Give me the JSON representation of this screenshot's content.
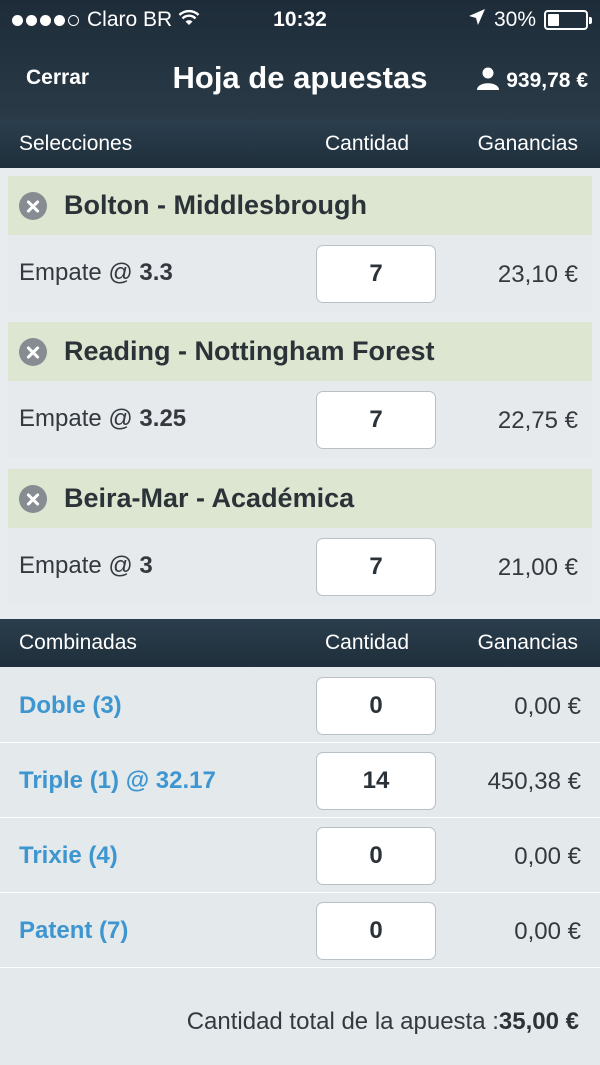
{
  "status_bar": {
    "carrier": "Claro BR",
    "time": "10:32",
    "battery_text": "30%",
    "battery_level": 0.3,
    "signal_bars": 4
  },
  "navbar": {
    "close_label": "Cerrar",
    "title": "Hoja de apuestas",
    "balance": "939,78 €"
  },
  "selections_header": {
    "col1": "Selecciones",
    "col2": "Cantidad",
    "col3": "Ganancias"
  },
  "selections": [
    {
      "match": "Bolton - Middlesbrough",
      "pick_label": "Empate @ ",
      "odds": "3.3",
      "stake": "7",
      "winnings": "23,10 €"
    },
    {
      "match": "Reading - Nottingham Forest",
      "pick_label": "Empate @ ",
      "odds": "3.25",
      "stake": "7",
      "winnings": "22,75 €"
    },
    {
      "match": "Beira-Mar - Académica",
      "pick_label": "Empate @ ",
      "odds": "3",
      "stake": "7",
      "winnings": "21,00 €"
    }
  ],
  "combined_header": {
    "col1": "Combinadas",
    "col2": "Cantidad",
    "col3": "Ganancias"
  },
  "combined": [
    {
      "name": "Doble (3)",
      "stake": "0",
      "winnings": "0,00 €"
    },
    {
      "name": "Triple (1) @ 32.17",
      "stake": "14",
      "winnings": "450,38 €"
    },
    {
      "name": "Trixie (4)",
      "stake": "0",
      "winnings": "0,00 €"
    },
    {
      "name": "Patent (7)",
      "stake": "0",
      "winnings": "0,00 €"
    }
  ],
  "total": {
    "label": "Cantidad total de la apuesta :",
    "amount": "35,00 €"
  },
  "colors": {
    "header_bg": "#1f2f3b",
    "selection_head_bg": "#dde6d1",
    "link_blue": "#3d96d0"
  },
  "icons": [
    "wifi-icon",
    "location-arrow-icon",
    "battery-icon",
    "user-icon",
    "remove-icon"
  ]
}
